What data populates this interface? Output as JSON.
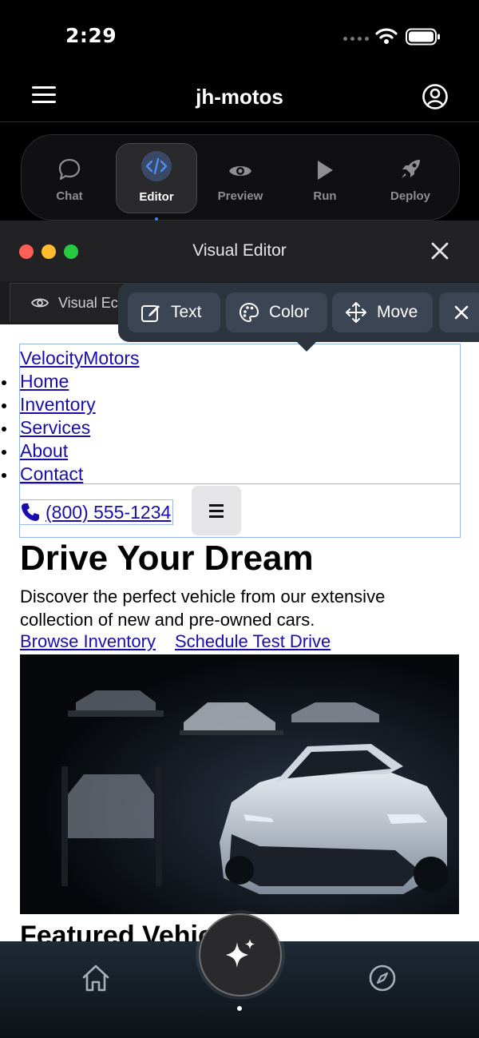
{
  "status_bar": {
    "time": "2:29"
  },
  "app_header": {
    "title": "jh-motos"
  },
  "tool_tabs": [
    {
      "label": "Chat",
      "icon": "chat-bubble-icon"
    },
    {
      "label": "Editor",
      "icon": "code-icon",
      "active": true
    },
    {
      "label": "Preview",
      "icon": "eye-icon"
    },
    {
      "label": "Run",
      "icon": "play-icon"
    },
    {
      "label": "Deploy",
      "icon": "rocket-icon"
    }
  ],
  "editor_window": {
    "title": "Visual Editor",
    "tab_label": "Visual Ec"
  },
  "floating_toolbar": {
    "text_label": "Text",
    "color_label": "Color",
    "move_label": "Move"
  },
  "site": {
    "brand": "VelocityMotors",
    "nav": [
      "Home",
      "Inventory",
      "Services",
      "About",
      "Contact"
    ],
    "phone": "(800) 555-1234",
    "hero_title": "Drive Your Dream",
    "hero_subtitle": "Discover the perfect vehicle from our extensive collection of new and pre-owned cars.",
    "cta_primary": "Browse Inventory",
    "cta_secondary": "Schedule Test Drive",
    "section_title": "Featured Vehicles"
  },
  "colors": {
    "accent": "#3b82f6",
    "link": "#1a0dab",
    "toolbar_bg": "#2c3440",
    "traffic_red": "#ff5f57",
    "traffic_yellow": "#febc2e",
    "traffic_green": "#28c840"
  }
}
